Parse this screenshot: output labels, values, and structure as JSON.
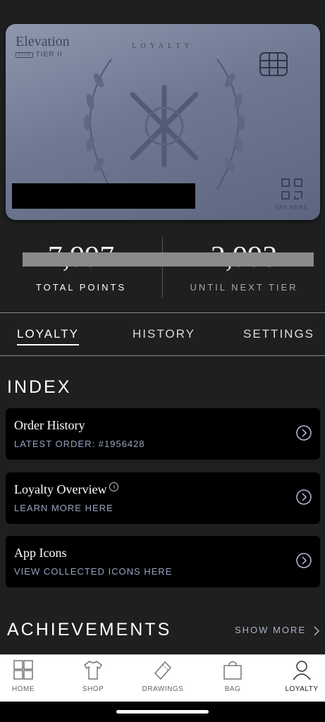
{
  "card": {
    "brand": "Elevation",
    "tier": "TIER II",
    "tier_badge": "10TH",
    "loyalty_word": "LOYALTY",
    "tap_here": "TAP HERE"
  },
  "points": {
    "total_value": "7,997",
    "total_label": "TOTAL POINTS",
    "next_value": "2,993",
    "next_label": "UNTIL NEXT TIER"
  },
  "tabs": [
    "LOYALTY",
    "HISTORY",
    "SETTINGS"
  ],
  "index": {
    "title": "INDEX",
    "items": [
      {
        "title": "Order History",
        "subtitle": "LATEST ORDER: #1956428"
      },
      {
        "title": "Loyalty Overview",
        "subtitle": "LEARN MORE HERE"
      },
      {
        "title": "App Icons",
        "subtitle": "VIEW COLLECTED ICONS HERE"
      }
    ]
  },
  "achievements": {
    "title": "ACHIEVEMENTS",
    "show_more": "SHOW MORE"
  },
  "nav": [
    {
      "label": "HOME",
      "icon": "home-grid-icon"
    },
    {
      "label": "SHOP",
      "icon": "tshirt-icon"
    },
    {
      "label": "DRAWINGS",
      "icon": "ticket-icon"
    },
    {
      "label": "BAG",
      "icon": "bag-icon"
    },
    {
      "label": "LOYALTY",
      "icon": "person-icon"
    }
  ],
  "colors": {
    "background": "#1f1f1f",
    "card": "#7a839b",
    "accent_subtitle": "#9aa3c0"
  }
}
